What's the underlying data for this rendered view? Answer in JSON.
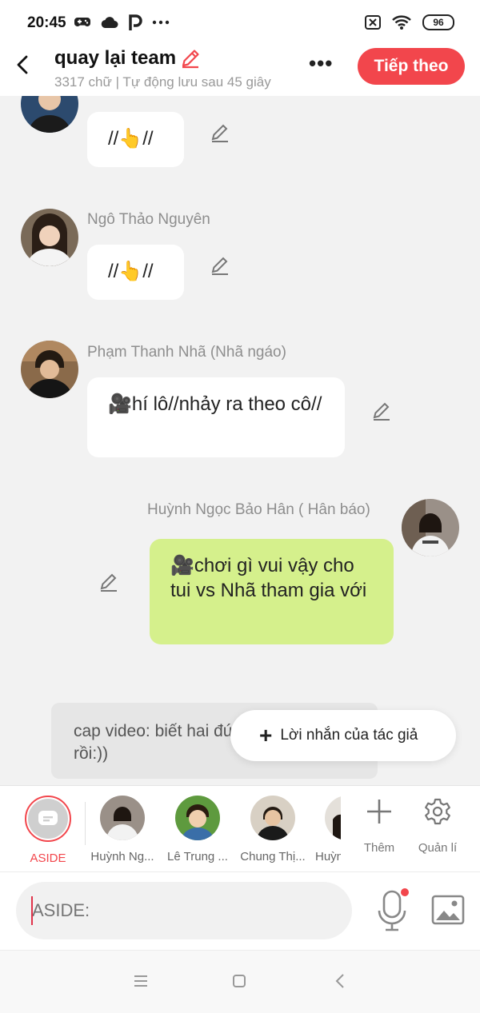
{
  "status_bar": {
    "time": "20:45",
    "battery": "96"
  },
  "header": {
    "title": "quay lại team",
    "subtitle": "3317 chữ | Tự động lưu sau 45 giây",
    "next_button": "Tiếp theo"
  },
  "messages": [
    {
      "name": "",
      "text": "//👆//",
      "side": "left"
    },
    {
      "name": "Ngô Thảo Nguyên",
      "text": "//👆//",
      "side": "left"
    },
    {
      "name": "Phạm Thanh Nhã (Nhã ngáo)",
      "text": "🎥hí lô//nhảy ra theo cô//",
      "side": "left"
    },
    {
      "name": "Huỳnh Ngọc Bảo Hân ( Hân báo)",
      "text": "🎥chơi gì vui vậy cho tui vs Nhã tham gia với",
      "side": "right"
    }
  ],
  "caption": "cap video: biết hai đứa này chơi ngầu rồi:))",
  "author_note_button": "Lời nhắn của tác giả",
  "characters": {
    "aside": "ASIDE",
    "items": [
      "Huỳnh Ng...",
      "Lê Trung ...",
      "Chung Thị...",
      "Huỳnh"
    ],
    "add_label": "Thêm",
    "manage_label": "Quản lí"
  },
  "input": {
    "placeholder": "ASIDE:"
  },
  "colors": {
    "accent": "#f2464c",
    "bubble_green": "#d5f08c"
  }
}
